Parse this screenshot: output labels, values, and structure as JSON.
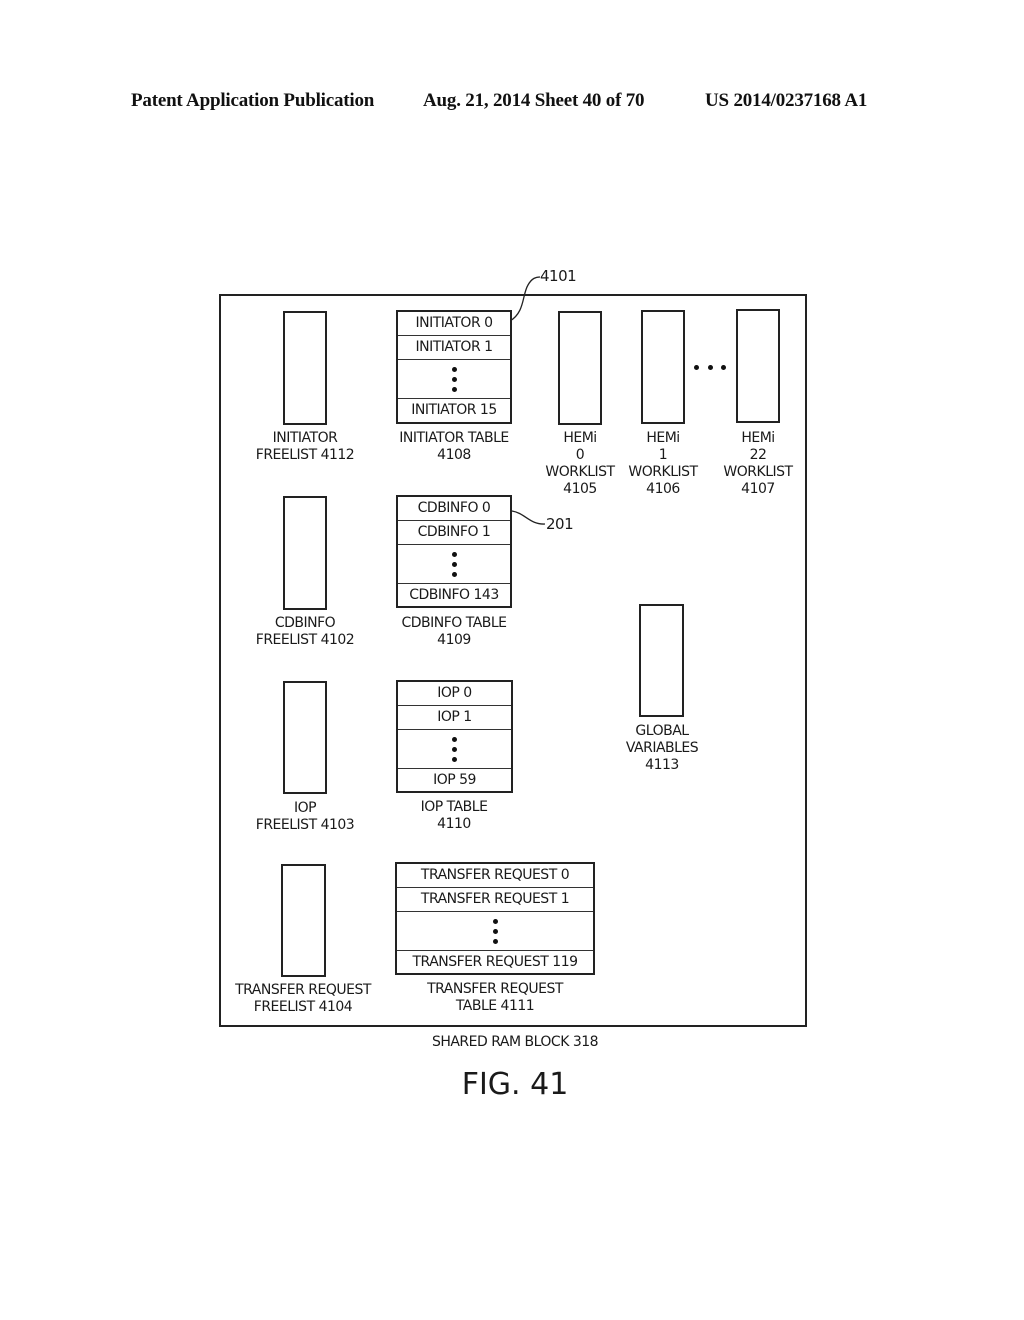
{
  "header": {
    "publication": "Patent Application Publication",
    "date_sheet": "Aug. 21, 2014  Sheet 40 of 70",
    "number": "US 2014/0237168 A1"
  },
  "refs": {
    "outer": "4101",
    "cdbinfo_entry": "201"
  },
  "freelists": {
    "initiator": {
      "line1": "INITIATOR",
      "line2": "FREELIST 4112"
    },
    "cdbinfo": {
      "line1": "CDBINFO",
      "line2": "FREELIST 4102"
    },
    "iop": {
      "line1": "IOP",
      "line2": "FREELIST 4103"
    },
    "transfer": {
      "line1": "TRANSFER REQUEST",
      "line2": "FREELIST 4104"
    }
  },
  "tables": {
    "initiator": {
      "rows": [
        "INITIATOR 0",
        "INITIATOR 1",
        "INITIATOR 15"
      ],
      "line1": "INITIATOR TABLE",
      "line2": "4108"
    },
    "cdbinfo": {
      "rows": [
        "CDBINFO 0",
        "CDBINFO 1",
        "CDBINFO 143"
      ],
      "line1": "CDBINFO TABLE",
      "line2": "4109"
    },
    "iop": {
      "rows": [
        "IOP 0",
        "IOP 1",
        "IOP 59"
      ],
      "line1": "IOP TABLE",
      "line2": "4110"
    },
    "transfer": {
      "rows": [
        "TRANSFER REQUEST 0",
        "TRANSFER REQUEST 1",
        "TRANSFER REQUEST 119"
      ],
      "line1": "TRANSFER REQUEST",
      "line2": "TABLE 4111"
    }
  },
  "worklists": [
    {
      "l1": "HEMi",
      "l2": "0",
      "l3": "WORKLIST",
      "l4": "4105"
    },
    {
      "l1": "HEMi",
      "l2": "1",
      "l3": "WORKLIST",
      "l4": "4106"
    },
    {
      "l1": "HEMi",
      "l2": "22",
      "l3": "WORKLIST",
      "l4": "4107"
    }
  ],
  "globals": {
    "l1": "GLOBAL",
    "l2": "VARIABLES",
    "l3": "4113"
  },
  "caption": "SHARED RAM BLOCK 318",
  "figure": "FIG. 41"
}
